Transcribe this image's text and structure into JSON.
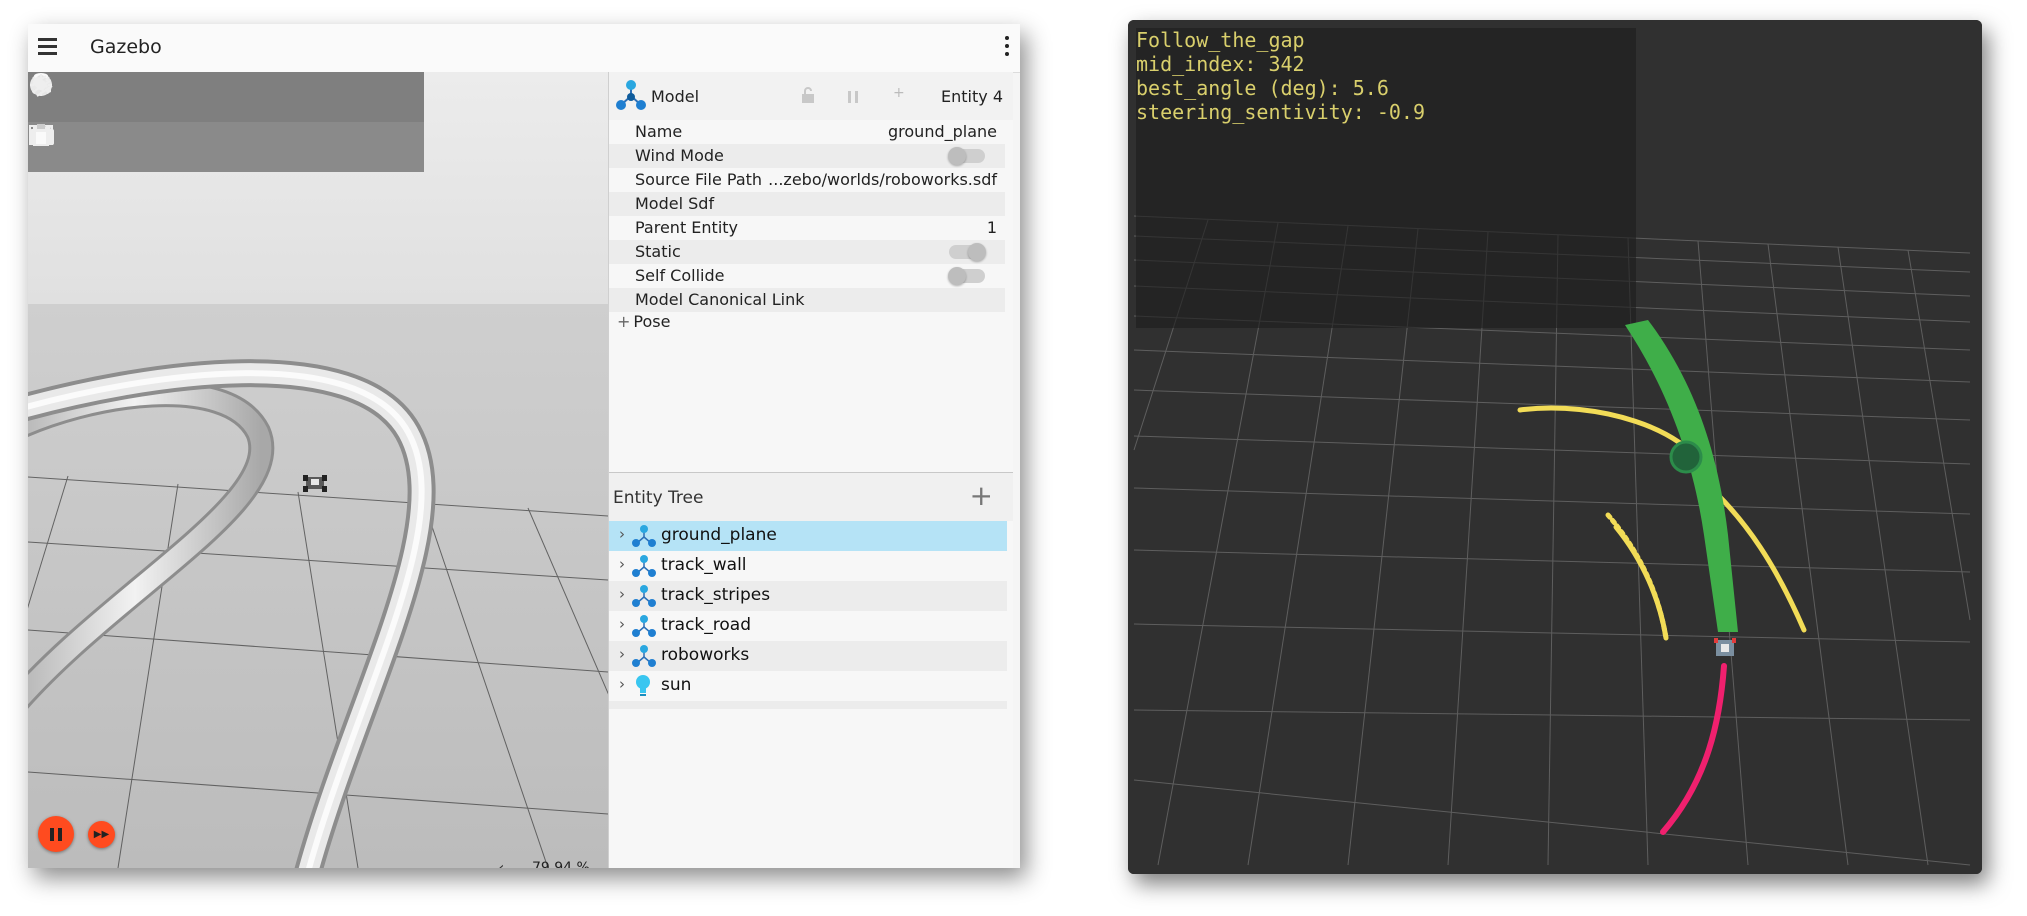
{
  "app": {
    "title": "Gazebo"
  },
  "viewport": {
    "real_time_factor": "79.94 %"
  },
  "shape_toolbar": {
    "row1": [
      "box-icon",
      "sphere-icon",
      "cylinder-icon",
      "capsule-icon",
      "ellipsoid-icon",
      "sun-light-icon",
      "directional-light-icon",
      "spot-light-icon"
    ],
    "row2": [
      "select-icon",
      "translate-icon",
      "rotate-icon",
      "transform-icon",
      "grid-icon",
      "camera-icon",
      "copy-icon",
      "paste-icon"
    ]
  },
  "component_inspector": {
    "type": "Model",
    "entity": "Entity 4",
    "properties": [
      {
        "label": "Name",
        "value": "ground_plane"
      },
      {
        "label": "Wind Mode",
        "value": ""
      },
      {
        "label": "Source File Path",
        "value": "...zebo/worlds/roboworks.sdf"
      },
      {
        "label": "Model Sdf",
        "value": ""
      },
      {
        "label": "Parent Entity",
        "value": "1"
      },
      {
        "label": "Static",
        "value": ""
      },
      {
        "label": "Self Collide",
        "value": ""
      },
      {
        "label": "Model Canonical Link",
        "value": ""
      }
    ],
    "pose_label": "Pose"
  },
  "entity_tree": {
    "title": "Entity Tree",
    "items": [
      "ground_plane",
      "track_wall",
      "track_stripes",
      "track_road",
      "roboworks",
      "sun"
    ]
  },
  "rviz_overlay": {
    "line1": "Follow_the_gap",
    "line2": "mid_index: 342",
    "line3": "best_angle (deg): 5.6",
    "line4": "steering_sentivity: -0.9"
  },
  "colors": {
    "gap_path": "#3fae49",
    "scan_points": "#f2dc57",
    "trajectory": "#f0206e",
    "play_button": "#ff4b1f",
    "selection": "#b5e3f6"
  }
}
